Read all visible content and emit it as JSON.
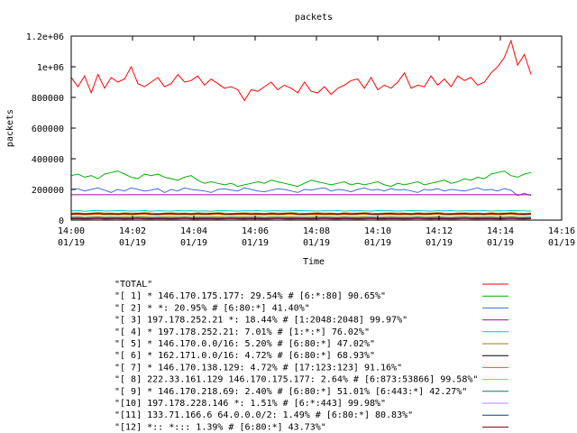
{
  "chart_data": {
    "type": "line",
    "title": "packets",
    "xlabel": "Time",
    "ylabel": "packets",
    "x_range_minutes": [
      0,
      16
    ],
    "ylim": [
      0,
      1200000
    ],
    "x_ticks": [
      {
        "line1": "14:00",
        "line2": "01/19"
      },
      {
        "line1": "14:02",
        "line2": "01/19"
      },
      {
        "line1": "14:04",
        "line2": "01/19"
      },
      {
        "line1": "14:06",
        "line2": "01/19"
      },
      {
        "line1": "14:08",
        "line2": "01/19"
      },
      {
        "line1": "14:10",
        "line2": "01/19"
      },
      {
        "line1": "14:12",
        "line2": "01/19"
      },
      {
        "line1": "14:14",
        "line2": "01/19"
      },
      {
        "line1": "14:16",
        "line2": "01/19"
      }
    ],
    "y_ticks": [
      "0",
      "200000",
      "400000",
      "600000",
      "800000",
      "1e+06",
      "1.2e+06"
    ],
    "y_tick_values": [
      0,
      200000,
      400000,
      600000,
      800000,
      1000000,
      1200000
    ],
    "legend_placement": "below",
    "grid": false,
    "series": [
      {
        "name": "\"TOTAL\"",
        "color": "#ff0000",
        "values": [
          930000,
          870000,
          940000,
          830000,
          950000,
          860000,
          930000,
          900000,
          920000,
          1000000,
          890000,
          870000,
          900000,
          930000,
          870000,
          890000,
          950000,
          900000,
          910000,
          940000,
          880000,
          920000,
          890000,
          860000,
          870000,
          850000,
          780000,
          850000,
          840000,
          870000,
          900000,
          850000,
          880000,
          860000,
          830000,
          900000,
          840000,
          830000,
          870000,
          820000,
          860000,
          880000,
          910000,
          920000,
          860000,
          930000,
          850000,
          880000,
          860000,
          900000,
          960000,
          860000,
          880000,
          870000,
          940000,
          880000,
          920000,
          870000,
          940000,
          910000,
          930000,
          880000,
          900000,
          960000,
          1000000,
          1060000,
          1170000,
          1010000,
          1080000,
          950000
        ]
      },
      {
        "name": "\"[ 1] * 146.170.175.177: 29.54% # [6:*:80] 90.65%\"",
        "color": "#00b000",
        "values": [
          290000,
          300000,
          280000,
          290000,
          270000,
          300000,
          310000,
          320000,
          300000,
          280000,
          270000,
          300000,
          290000,
          300000,
          280000,
          270000,
          260000,
          280000,
          290000,
          260000,
          240000,
          250000,
          240000,
          230000,
          240000,
          220000,
          230000,
          240000,
          250000,
          240000,
          260000,
          250000,
          240000,
          230000,
          220000,
          240000,
          260000,
          250000,
          240000,
          230000,
          240000,
          250000,
          230000,
          240000,
          230000,
          240000,
          250000,
          230000,
          220000,
          240000,
          230000,
          240000,
          250000,
          230000,
          240000,
          250000,
          260000,
          240000,
          250000,
          270000,
          260000,
          280000,
          270000,
          300000,
          310000,
          320000,
          290000,
          280000,
          300000,
          310000
        ]
      },
      {
        "name": "\"[ 2] * *: 20.95% # [6:80:*] 41.40%\"",
        "color": "#3b6fd6",
        "values": [
          200000,
          205000,
          190000,
          200000,
          210000,
          195000,
          180000,
          200000,
          190000,
          210000,
          200000,
          190000,
          195000,
          205000,
          180000,
          200000,
          190000,
          210000,
          200000,
          195000,
          190000,
          180000,
          200000,
          205000,
          195000,
          190000,
          210000,
          200000,
          190000,
          185000,
          195000,
          205000,
          200000,
          190000,
          180000,
          200000,
          195000,
          205000,
          210000,
          190000,
          200000,
          195000,
          185000,
          200000,
          210000,
          195000,
          200000,
          190000,
          205000,
          195000,
          200000,
          190000,
          180000,
          200000,
          195000,
          205000,
          190000,
          200000,
          195000,
          190000,
          200000,
          210000,
          195000,
          200000,
          190000,
          205000,
          195000,
          160000,
          175000,
          160000
        ]
      },
      {
        "name": "\"[ 3] 197.178.252.21 *: 18.44% # [1:2048:2048] 99.97%\"",
        "color": "#b000b0",
        "values": [
          165000,
          165000,
          165000,
          165000,
          165000,
          165000,
          165000,
          165000,
          165000,
          165000,
          165000,
          165000,
          165000,
          165000,
          165000,
          165000,
          165000,
          165000,
          165000,
          165000,
          165000,
          165000,
          165000,
          165000,
          165000,
          165000,
          165000,
          165000,
          165000,
          165000,
          165000,
          165000,
          165000,
          165000,
          165000,
          165000,
          165000,
          165000,
          165000,
          165000,
          165000,
          165000,
          165000,
          165000,
          165000,
          165000,
          165000,
          165000,
          165000,
          165000,
          165000,
          165000,
          165000,
          165000,
          165000,
          165000,
          165000,
          165000,
          165000,
          165000,
          165000,
          165000,
          165000,
          165000,
          165000,
          165000,
          165000,
          165000,
          165000,
          165000
        ]
      },
      {
        "name": "\"[ 4] * 197.178.252.21: 7.01% # [1:*:*] 76.02%\"",
        "color": "#00c8c8",
        "values": [
          60000,
          62000,
          58000,
          61000,
          63000,
          59000,
          60000,
          62000,
          61000,
          59000,
          60000,
          62000,
          58000,
          61000,
          60000,
          59000,
          62000,
          60000,
          61000,
          59000,
          60000,
          58000,
          62000,
          61000,
          60000,
          59000,
          61000,
          60000,
          62000,
          59000,
          60000,
          61000,
          59000,
          60000,
          62000,
          61000,
          60000,
          59000,
          61000,
          60000,
          62000,
          59000,
          60000,
          61000,
          60000,
          59000,
          62000,
          60000,
          61000,
          59000,
          60000,
          62000,
          61000,
          60000,
          59000,
          61000,
          60000,
          62000,
          59000,
          60000,
          61000,
          60000,
          62000,
          59000,
          61000,
          60000,
          62000,
          61000,
          60000,
          59000
        ]
      },
      {
        "name": "\"[ 5] * 146.170.0.0/16: 5.20% # [6:80:*] 47.02%\"",
        "color": "#a08000",
        "values": [
          45000,
          47000,
          44000,
          46000,
          48000,
          45000,
          46000,
          44000,
          47000,
          45000,
          46000,
          48000,
          45000,
          44000,
          46000,
          47000,
          45000,
          46000,
          44000,
          47000,
          45000,
          46000,
          48000,
          45000,
          44000,
          46000,
          47000,
          45000,
          46000,
          44000,
          47000,
          45000,
          46000,
          48000,
          45000,
          44000,
          46000,
          47000,
          45000,
          46000,
          44000,
          47000,
          45000,
          46000,
          48000,
          45000,
          44000,
          46000,
          47000,
          45000,
          46000,
          44000,
          47000,
          45000,
          46000,
          48000,
          45000,
          44000,
          46000,
          47000,
          45000,
          46000,
          44000,
          47000,
          45000,
          46000,
          48000,
          45000,
          44000,
          46000
        ]
      },
      {
        "name": "\"[ 6] * 162.171.0.0/16: 4.72% # [6:80:*] 68.93%\"",
        "color": "#000000",
        "values": [
          40000,
          42000,
          39000,
          41000,
          43000,
          40000,
          41000,
          39000,
          42000,
          40000,
          41000,
          43000,
          40000,
          39000,
          41000,
          42000,
          40000,
          41000,
          39000,
          42000,
          40000,
          41000,
          43000,
          40000,
          39000,
          41000,
          42000,
          40000,
          41000,
          39000,
          42000,
          40000,
          41000,
          43000,
          40000,
          39000,
          41000,
          42000,
          40000,
          41000,
          39000,
          42000,
          40000,
          41000,
          43000,
          40000,
          39000,
          41000,
          42000,
          40000,
          41000,
          39000,
          42000,
          40000,
          41000,
          43000,
          40000,
          39000,
          41000,
          42000,
          40000,
          41000,
          39000,
          42000,
          40000,
          41000,
          43000,
          40000,
          39000,
          41000
        ]
      },
      {
        "name": "\"[ 7] * 146.170.138.129: 4.72% # [17:123:123] 91.16%\"",
        "color": "#ff5000",
        "values": [
          35000,
          37000,
          34000,
          36000,
          38000,
          35000,
          36000,
          34000,
          37000,
          35000,
          36000,
          38000,
          35000,
          34000,
          36000,
          37000,
          35000,
          36000,
          34000,
          37000,
          35000,
          36000,
          38000,
          35000,
          34000,
          36000,
          37000,
          35000,
          36000,
          34000,
          37000,
          35000,
          36000,
          38000,
          35000,
          34000,
          36000,
          37000,
          35000,
          36000,
          34000,
          37000,
          35000,
          36000,
          38000,
          35000,
          34000,
          36000,
          37000,
          35000,
          36000,
          34000,
          37000,
          35000,
          36000,
          38000,
          35000,
          34000,
          36000,
          37000,
          35000,
          36000,
          34000,
          37000,
          35000,
          36000,
          38000,
          35000,
          34000,
          36000
        ]
      },
      {
        "name": "\"[ 8] 222.33.161.129 146.170.175.177: 2.64% # [6:873:53866] 99.58%\"",
        "color": "#e0b000",
        "values": [
          20000,
          22000,
          19000,
          21000,
          23000,
          20000,
          21000,
          19000,
          22000,
          20000,
          21000,
          23000,
          20000,
          19000,
          21000,
          22000,
          20000,
          21000,
          19000,
          22000,
          20000,
          21000,
          23000,
          20000,
          19000,
          21000,
          22000,
          20000,
          21000,
          19000,
          22000,
          20000,
          21000,
          23000,
          20000,
          19000,
          21000,
          22000,
          20000,
          21000,
          19000,
          22000,
          20000,
          21000,
          23000,
          20000,
          19000,
          21000,
          22000,
          20000,
          21000,
          19000,
          22000,
          20000,
          21000,
          23000,
          20000,
          19000,
          21000,
          22000,
          20000,
          21000,
          19000,
          22000,
          20000,
          21000,
          23000,
          20000,
          19000,
          21000
        ]
      },
      {
        "name": "\"[ 9] * 146.170.218.69: 2.40% # [6:80:*] 51.01% [6:443:*] 42.27%\"",
        "color": "#008060",
        "values": [
          18000,
          19000,
          17000,
          18500,
          20000,
          17500,
          18000,
          19000,
          17000,
          18500,
          20000,
          18000,
          17500,
          19000,
          18000,
          17000,
          18500,
          20000,
          18000,
          17500,
          19000,
          18000,
          17000,
          18500,
          20000,
          18000,
          17500,
          19000,
          18000,
          17000,
          18500,
          20000,
          18000,
          17500,
          19000,
          18000,
          17000,
          18500,
          20000,
          18000,
          17500,
          19000,
          18000,
          17000,
          18500,
          20000,
          18000,
          17500,
          19000,
          18000,
          17000,
          18500,
          20000,
          18000,
          17500,
          19000,
          18000,
          17000,
          18500,
          20000,
          18000,
          17500,
          19000,
          18000,
          17000,
          18500,
          20000,
          18000,
          17500,
          19000
        ]
      },
      {
        "name": "\"[10] 197.178.228.146 *: 1.51% # [6:*:443] 99.98%\"",
        "color": "#c080ff",
        "values": [
          12000,
          13000,
          11000,
          12500,
          14000,
          11500,
          12000,
          13000,
          11000,
          12500,
          14000,
          12000,
          11500,
          13000,
          12000,
          11000,
          12500,
          14000,
          12000,
          11500,
          13000,
          12000,
          11000,
          12500,
          14000,
          12000,
          11500,
          13000,
          12000,
          11000,
          12500,
          14000,
          12000,
          11500,
          13000,
          12000,
          11000,
          12500,
          14000,
          12000,
          11500,
          13000,
          12000,
          11000,
          12500,
          14000,
          12000,
          11500,
          13000,
          12000,
          11000,
          12500,
          14000,
          12000,
          11500,
          13000,
          12000,
          11000,
          12500,
          14000,
          12000,
          11500,
          13000,
          12000,
          11000,
          12500,
          14000,
          12000,
          11500,
          13000
        ]
      },
      {
        "name": "\"[11] 133.71.166.6 64.0.0.0/2: 1.49% # [6:80:*] 80.83%\"",
        "color": "#004080",
        "values": [
          10000,
          11000,
          9500,
          10500,
          12000,
          9800,
          10000,
          11000,
          9500,
          10500,
          12000,
          10000,
          9800,
          11000,
          10000,
          9500,
          10500,
          12000,
          10000,
          9800,
          11000,
          10000,
          9500,
          10500,
          12000,
          10000,
          9800,
          11000,
          10000,
          9500,
          10500,
          12000,
          10000,
          9800,
          11000,
          10000,
          9500,
          10500,
          12000,
          10000,
          9800,
          11000,
          10000,
          9500,
          10500,
          12000,
          10000,
          9800,
          11000,
          10000,
          9500,
          10500,
          12000,
          10000,
          9800,
          11000,
          10000,
          9500,
          10500,
          12000,
          10000,
          9800,
          11000,
          10000,
          9500,
          10500,
          12000,
          10000,
          9800,
          11000
        ]
      },
      {
        "name": "\"[12] *:: *::: 1.39% # [6:80:*] 43.73%\"",
        "color": "#800000",
        "values": [
          8000,
          9000,
          7500,
          8500,
          10000,
          7800,
          8000,
          9000,
          7500,
          8500,
          10000,
          8000,
          7800,
          9000,
          8000,
          7500,
          8500,
          10000,
          8000,
          7800,
          9000,
          8000,
          7500,
          8500,
          10000,
          8000,
          7800,
          9000,
          8000,
          7500,
          8500,
          10000,
          8000,
          7800,
          9000,
          8000,
          7500,
          8500,
          10000,
          8000,
          7800,
          9000,
          8000,
          7500,
          8500,
          10000,
          8000,
          7800,
          9000,
          8000,
          7500,
          8500,
          10000,
          8000,
          7800,
          9000,
          8000,
          7500,
          8500,
          10000,
          8000,
          7800,
          9000,
          8000,
          7500,
          8500,
          10000,
          8000,
          7800,
          9000
        ]
      }
    ]
  }
}
